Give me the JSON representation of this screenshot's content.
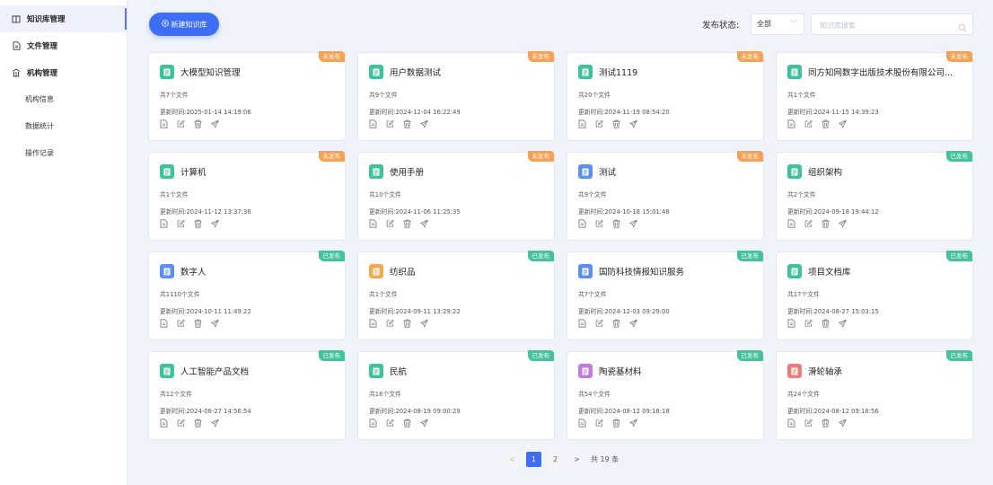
{
  "sidebar": {
    "items": [
      {
        "label": "知识库管理",
        "icon": "book-icon"
      },
      {
        "label": "文件管理",
        "icon": "file-icon"
      },
      {
        "label": "机构管理",
        "icon": "institution-icon"
      }
    ],
    "subitems": [
      "机构信息",
      "数据统计",
      "操作记录"
    ]
  },
  "toolbar": {
    "new_button_label": "新建知识库",
    "status_label": "发布状态:",
    "status_value": "全部",
    "search_placeholder": "知识库搜索"
  },
  "colors": {
    "primary": "#3d6ef5",
    "unpublished": "#f6a153",
    "published": "#44c29b"
  },
  "cards": [
    {
      "title": "大模型知识管理",
      "files": "共7个文件",
      "updated": "更新时间:2025-01-14 14:19:06",
      "status": "未发布",
      "icon_color": "#3cc39a"
    },
    {
      "title": "用户数据测试",
      "files": "共9个文件",
      "updated": "更新时间:2024-12-04 16:22:49",
      "status": "未发布",
      "icon_color": "#3cc39a"
    },
    {
      "title": "测试1119",
      "files": "共20个文件",
      "updated": "更新时间:2024-11-19 08:54:20",
      "status": "未发布",
      "icon_color": "#3cc39a"
    },
    {
      "title": "同方知网数字出版技术股份有限公司...",
      "files": "共1个文件",
      "updated": "更新时间:2024-11-15 14:39:23",
      "status": "未发布",
      "icon_color": "#3cc39a"
    },
    {
      "title": "计算机",
      "files": "共1个文件",
      "updated": "更新时间:2024-11-12 13:37:36",
      "status": "未发布",
      "icon_color": "#3cc39a"
    },
    {
      "title": "使用手册",
      "files": "共10个文件",
      "updated": "更新时间:2024-11-06 11:25:35",
      "status": "未发布",
      "icon_color": "#3cc39a"
    },
    {
      "title": "测试",
      "files": "共9个文件",
      "updated": "更新时间:2024-10-18 15:01:48",
      "status": "未发布",
      "icon_color": "#5b8ff2"
    },
    {
      "title": "组织架构",
      "files": "共2个文件",
      "updated": "更新时间:2024-09-18 19:44:12",
      "status": "已发布",
      "icon_color": "#3cc39a"
    },
    {
      "title": "数字人",
      "files": "共1110个文件",
      "updated": "更新时间:2024-10-11 11:49:22",
      "status": "已发布",
      "icon_color": "#5b8ff2"
    },
    {
      "title": "纺织品",
      "files": "共1个文件",
      "updated": "更新时间:2024-09-11 13:29:22",
      "status": "已发布",
      "icon_color": "#f5a94c"
    },
    {
      "title": "国防科技情报知识服务",
      "files": "共7个文件",
      "updated": "更新时间:2024-12-03 09:29:00",
      "status": "已发布",
      "icon_color": "#5b8ff2"
    },
    {
      "title": "项目文档库",
      "files": "共17个文件",
      "updated": "更新时间:2024-08-27 15:03:15",
      "status": "已发布",
      "icon_color": "#3cc39a"
    },
    {
      "title": "人工智能产品文档",
      "files": "共12个文件",
      "updated": "更新时间:2024-08-27 14:56:54",
      "status": "已发布",
      "icon_color": "#3cc39a"
    },
    {
      "title": "民航",
      "files": "共16个文件",
      "updated": "更新时间:2024-08-19 09:00:29",
      "status": "已发布",
      "icon_color": "#3cc39a"
    },
    {
      "title": "陶瓷基材料",
      "files": "共54个文件",
      "updated": "更新时间:2024-08-12 09:18:18",
      "status": "已发布",
      "icon_color": "#c07be0"
    },
    {
      "title": "滑轮轴承",
      "files": "共24个文件",
      "updated": "更新时间:2024-08-12 09:16:56",
      "status": "已发布",
      "icon_color": "#f07a7a"
    }
  ],
  "pagination": {
    "pages": [
      "1",
      "2"
    ],
    "current": "1",
    "total_text": "共 19 条"
  }
}
